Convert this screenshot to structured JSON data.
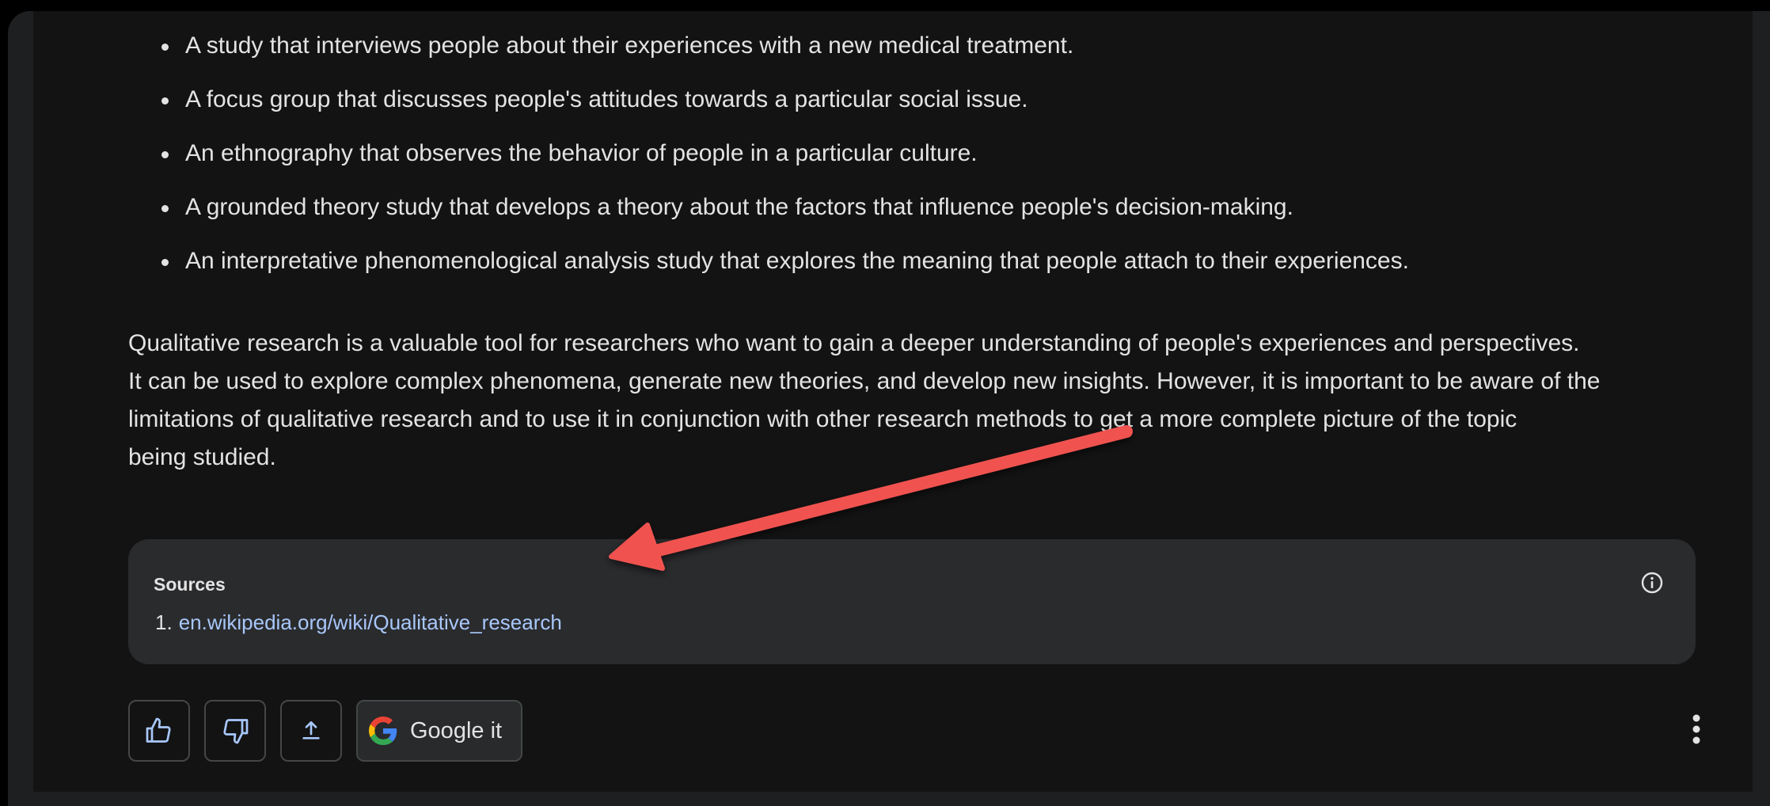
{
  "response": {
    "examples": [
      "A study that interviews people about their experiences with a new medical treatment.",
      "A focus group that discusses people's attitudes towards a particular social issue.",
      "An ethnography that observes the behavior of people in a particular culture.",
      "A grounded theory study that develops a theory about the factors that influence people's decision-making.",
      "An interpretative phenomenological analysis study that explores the meaning that people attach to their experiences."
    ],
    "summary_lines": [
      "Qualitative research is a valuable tool for researchers who want to gain a deeper understanding of people's experiences and perspectives.",
      "It can be used to explore complex phenomena, generate new theories, and develop new insights. However, it is important to be aware of the",
      "limitations of qualitative research and to use it in conjunction with other research methods to get a more complete picture of the topic",
      "being studied."
    ]
  },
  "sources": {
    "title": "Sources",
    "items": [
      {
        "number": "1.",
        "link": "en.wikipedia.org/wiki/Qualitative_research"
      }
    ]
  },
  "actions": {
    "good_response_icon": "thumbs-up-icon",
    "bad_response_icon": "thumbs-down-icon",
    "share_icon": "share-icon",
    "google_it_label": "Google it",
    "more_icon": "more-vertical-icon"
  },
  "colors": {
    "background": "#131314",
    "text": "#e3e3e3",
    "link": "#a8c7fa",
    "card": "#2a2b2d",
    "annotation_arrow": "#f0524f"
  }
}
